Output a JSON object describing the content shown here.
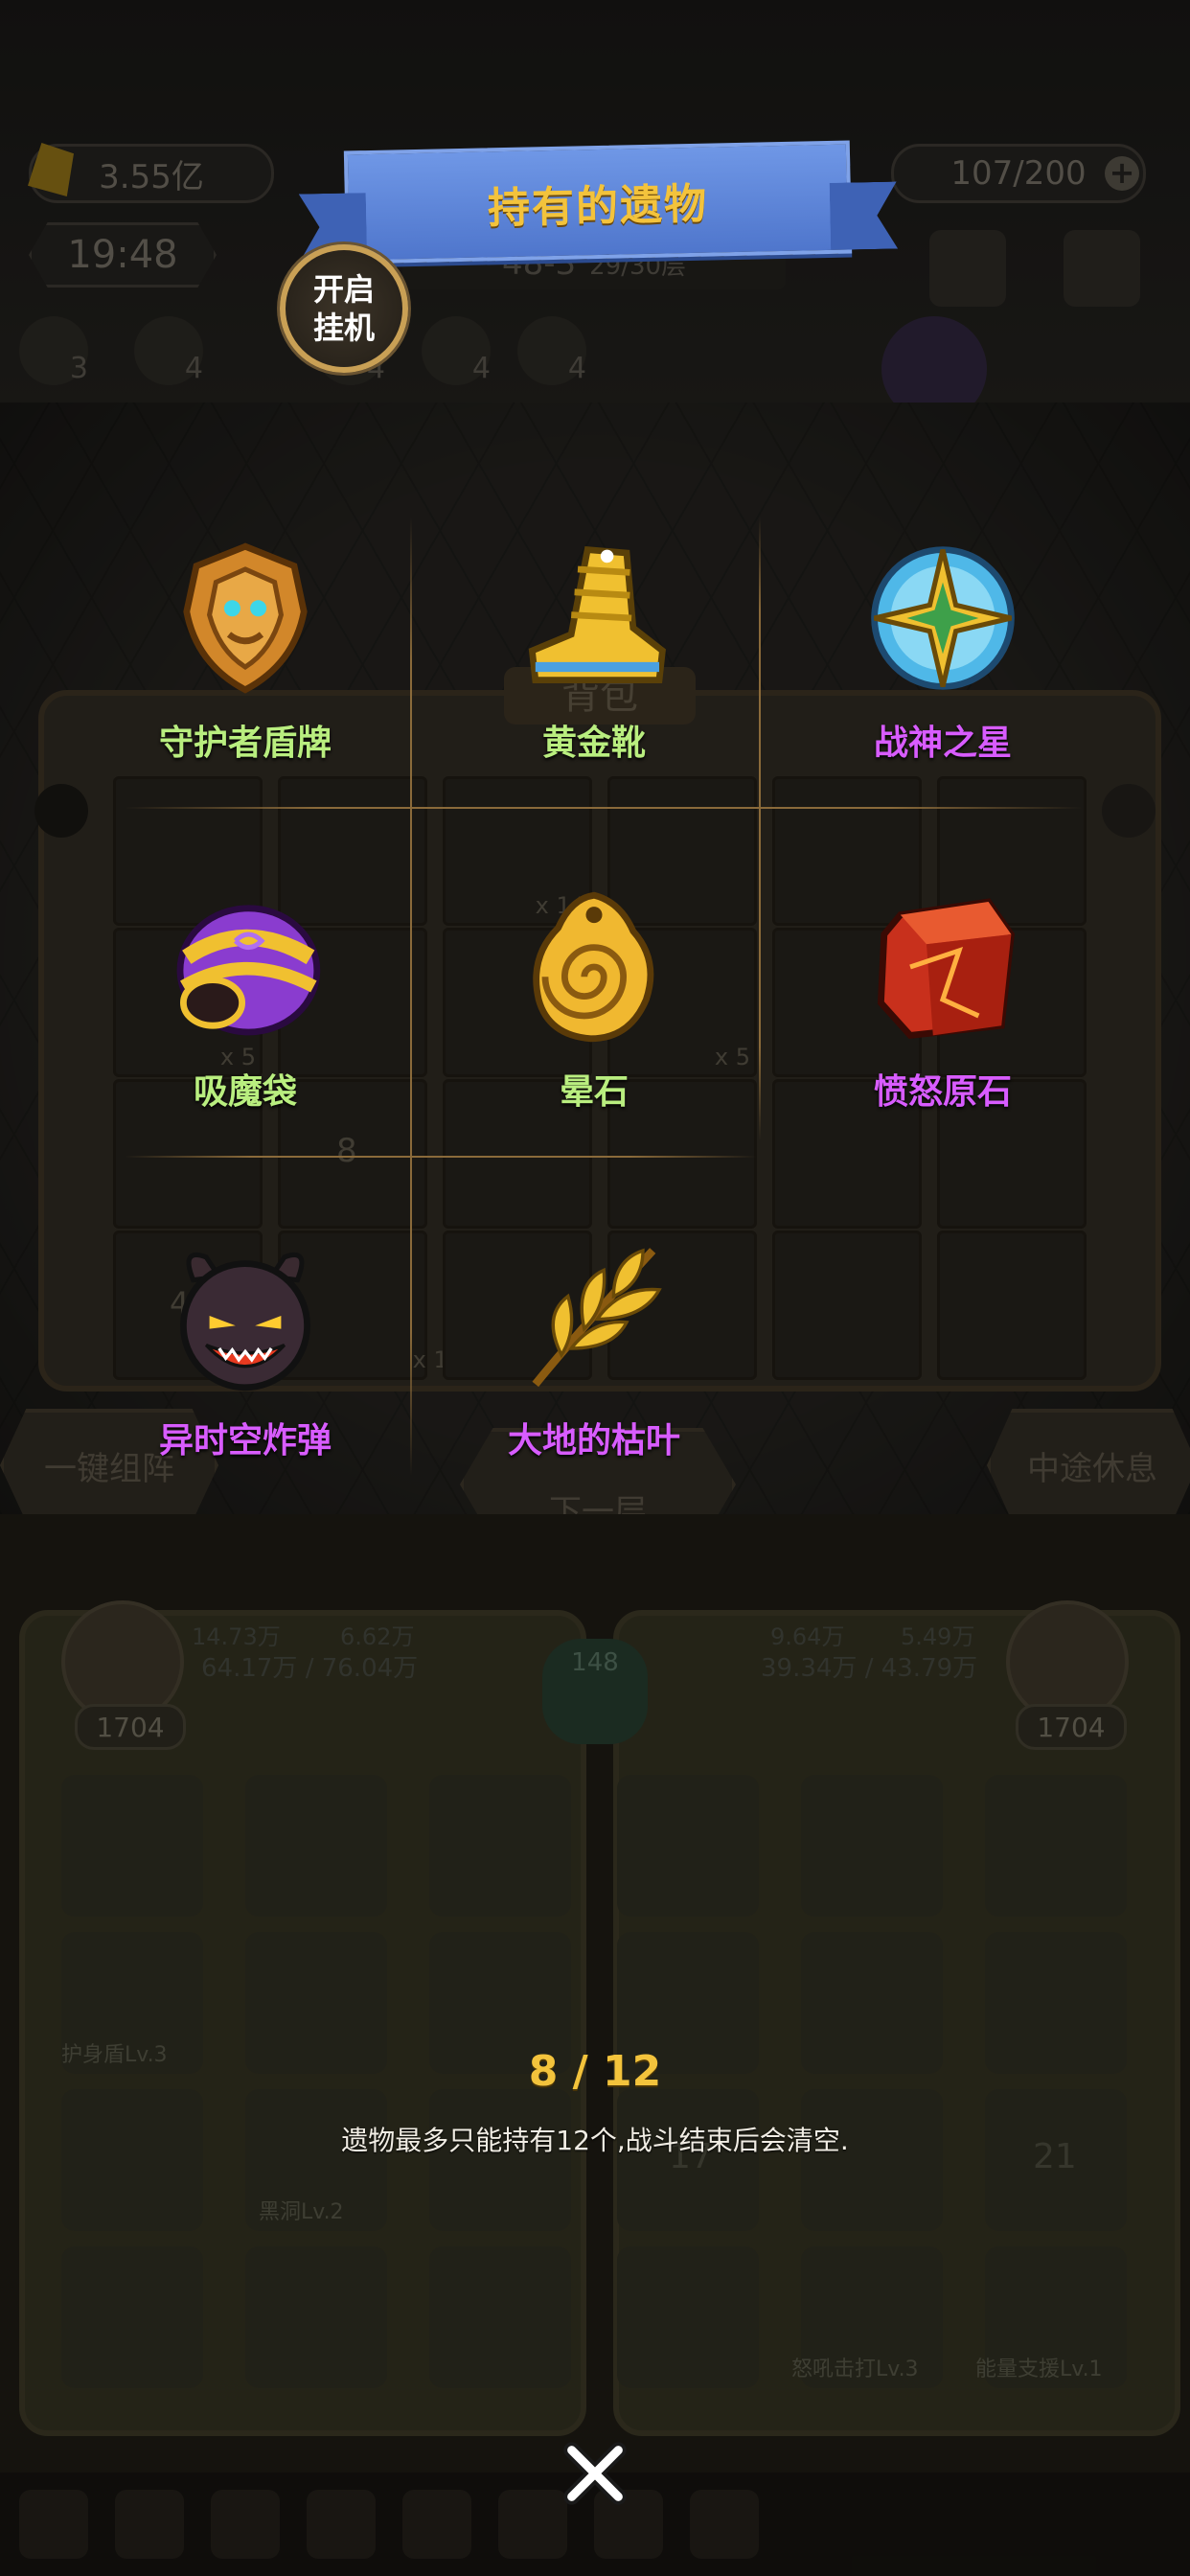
{
  "hud": {
    "gold": "3.55亿",
    "stamina": "107/200",
    "clock": "19:48",
    "floor": "48-3",
    "floor_progress": "29/30层",
    "buff_counts": [
      "3",
      "4",
      "4",
      "4",
      "4"
    ]
  },
  "bag": {
    "title": "背包",
    "slot_counts": [
      "x 14",
      "x 5",
      "x 5",
      "8",
      "4",
      "x 11"
    ],
    "left_button": "一键组阵",
    "center_button": "下一层",
    "right_button": "中途休息"
  },
  "team": {
    "left": {
      "attack": "14.73万",
      "defense": "6.62万",
      "hp": "64.17万 / 76.04万",
      "level": "1704"
    },
    "center_badge": "148",
    "right": {
      "attack": "9.64万",
      "defense": "5.49万",
      "hp": "39.34万 / 43.79万",
      "level": "1704"
    },
    "skills": [
      "护身盾Lv.3",
      "黑洞Lv.2",
      "怒吼击打Lv.3",
      "能量支援Lv.1"
    ],
    "stack_counts": [
      "17",
      "21"
    ]
  },
  "popup": {
    "title": "持有的遗物",
    "auto_button": "开启\n挂机",
    "relics": [
      {
        "name": "守护者盾牌",
        "rarity": "normal",
        "icon": "shield-relic-icon"
      },
      {
        "name": "黄金靴",
        "rarity": "normal",
        "icon": "golden-boot-icon"
      },
      {
        "name": "战神之星",
        "rarity": "rare",
        "icon": "star-of-war-icon"
      },
      {
        "name": "吸魔袋",
        "rarity": "normal",
        "icon": "magic-bag-icon"
      },
      {
        "name": "晕石",
        "rarity": "normal",
        "icon": "stun-stone-icon"
      },
      {
        "name": "愤怒原石",
        "rarity": "rare",
        "icon": "rage-stone-icon"
      },
      {
        "name": "异时空炸弹",
        "rarity": "rare",
        "icon": "demon-bomb-icon"
      },
      {
        "name": "大地的枯叶",
        "rarity": "rare",
        "icon": "withered-leaf-icon"
      }
    ],
    "count": "8 / 12",
    "note": "遗物最多只能持有12个,战斗结束后会清空."
  },
  "colors": {
    "rare": "#d85cff",
    "normal": "#b9ee7f",
    "title_gold": "#f3c33c",
    "banner_blue": "#5b82d8"
  }
}
